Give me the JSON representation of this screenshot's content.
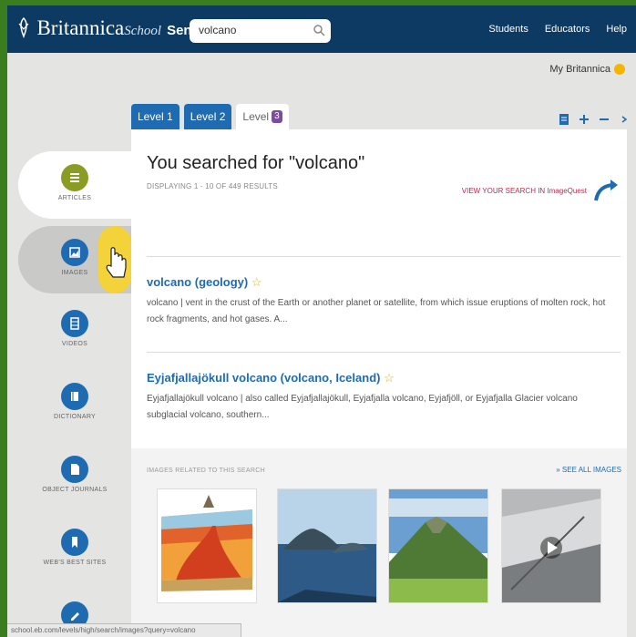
{
  "header": {
    "brand": "Britannica",
    "school": "School",
    "level_name": "Senior",
    "search_value": "volcano",
    "nav": [
      "Students",
      "Educators",
      "Help"
    ]
  },
  "account": {
    "my_britannica": "My Britannica"
  },
  "tabs": [
    {
      "label": "Level 1"
    },
    {
      "label": "Level 2"
    },
    {
      "label": "Level",
      "badge": "3"
    }
  ],
  "sidebar": {
    "items": [
      {
        "label": "ARTICLES",
        "icon": "articles-icon",
        "color": "#8b9c24"
      },
      {
        "label": "IMAGES",
        "icon": "images-icon",
        "color": "#1e6bb2"
      },
      {
        "label": "VIDEOS",
        "icon": "videos-icon",
        "color": "#1e6bb2"
      },
      {
        "label": "DICTIONARY",
        "icon": "dictionary-icon",
        "color": "#1e6bb2"
      },
      {
        "label": "OBJECT JOURNALS",
        "icon": "journals-icon",
        "color": "#1e6bb2"
      },
      {
        "label": "WEB'S BEST SITES",
        "icon": "bookmark-icon",
        "color": "#1e6bb2"
      },
      {
        "label": "",
        "icon": "edit-icon",
        "color": "#1e6bb2"
      }
    ]
  },
  "main": {
    "heading": "You searched for \"volcano\"",
    "subheading": "DISPLAYING 1 - 10 OF 449 RESULTS",
    "imagequest_label": "VIEW YOUR SEARCH IN ImageQuest",
    "results": [
      {
        "title": "volcano (geology)",
        "star": "☆",
        "snippet": "volcano  |  vent in the crust of the Earth or another planet or satellite, from which issue eruptions of molten rock, hot rock fragments, and hot gases. A..."
      },
      {
        "title": "Eyjafjallajökull volcano (volcano, Iceland)",
        "star": "☆",
        "snippet": "Eyjafjallajökull volcano  |  also called Eyjafjallajökull,  Eyjafjalla volcano,  Eyjafjöll,  or Eyjafjalla Glacier volcano   subglacial volcano, southern..."
      }
    ],
    "images_heading": "IMAGES RELATED TO THIS SEARCH",
    "see_all": "» SEE ALL IMAGES"
  },
  "status_bar": "school.eb.com/levels/high/search/images?query=volcano",
  "colors": {
    "header_bg": "#0d3a63",
    "tab_blue": "#1e6bb2",
    "level3_badge": "#7a4d9d",
    "articles_green": "#8b9c24",
    "imagequest_red": "#c0294e"
  }
}
